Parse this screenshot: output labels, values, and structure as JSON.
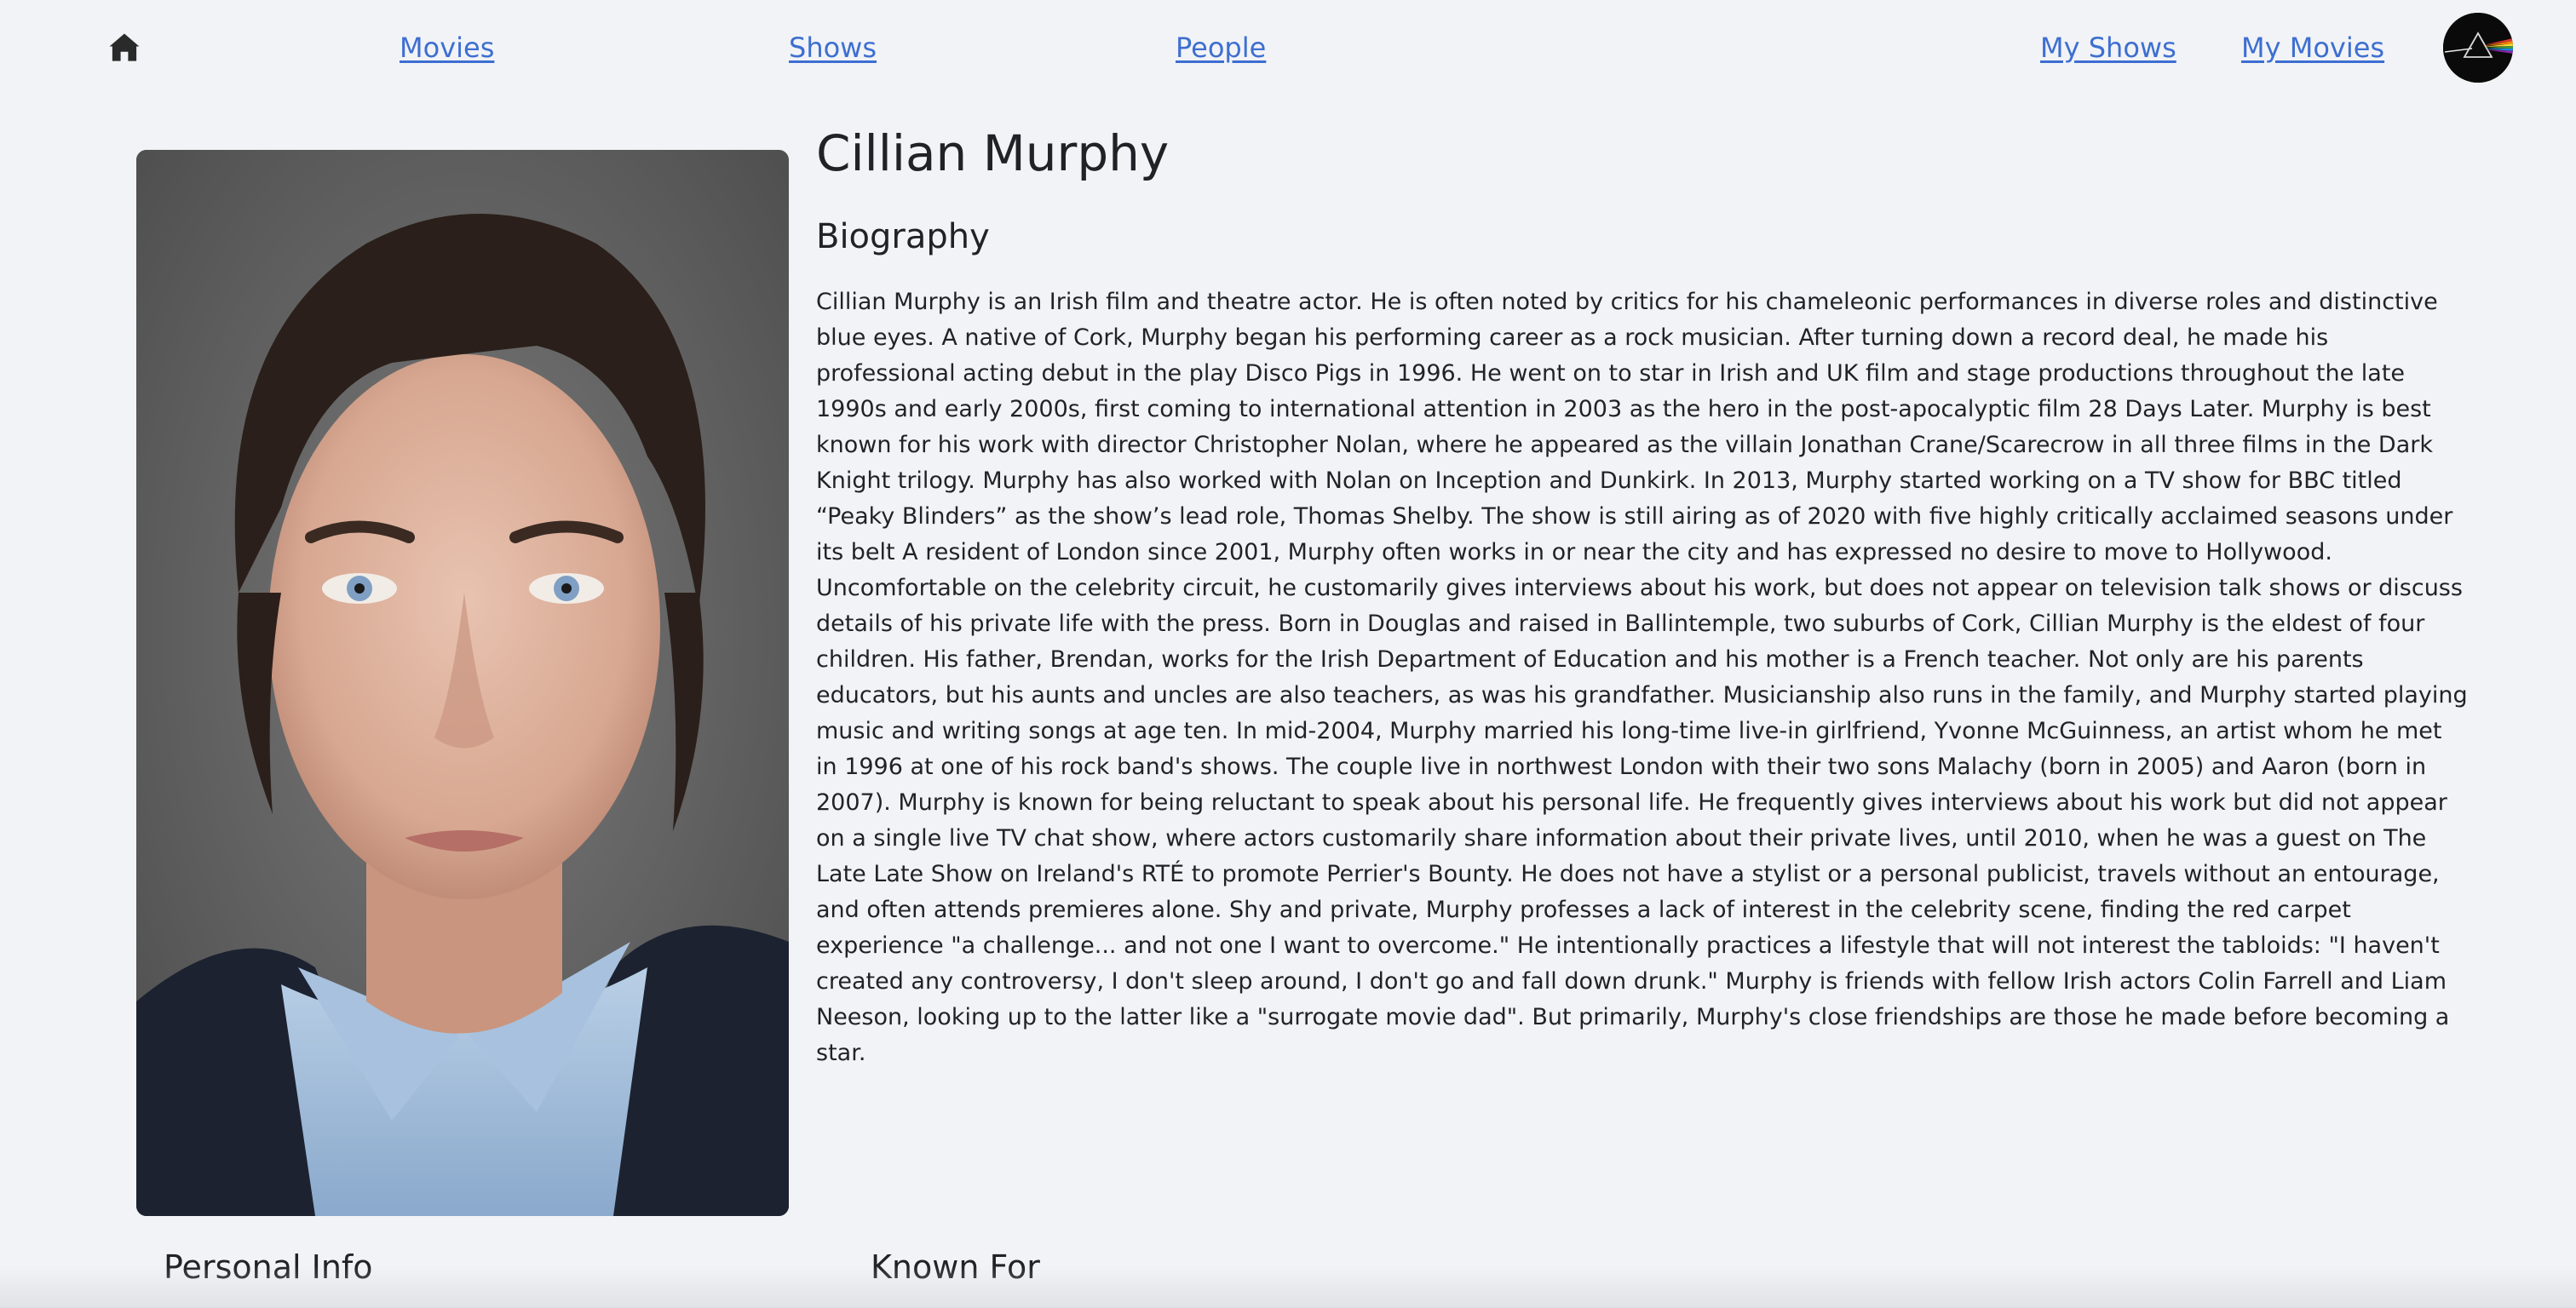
{
  "nav": {
    "home_icon": "home-icon",
    "movies_label": "Movies",
    "shows_label": "Shows",
    "people_label": "People",
    "my_shows_label": "My Shows",
    "my_movies_label": "My Movies",
    "avatar_icon": "prism-avatar-icon",
    "link_color": "#3d6fd1"
  },
  "person": {
    "name": "Cillian Murphy",
    "biography_heading": "Biography",
    "biography": "Cillian Murphy is an Irish film and theatre actor. He is often noted by critics for his chameleonic performances in diverse roles and distinctive blue eyes. A native of Cork, Murphy began his performing career as a rock musician. After turning down a record deal, he made his professional acting debut in the play Disco Pigs in 1996. He went on to star in Irish and UK film and stage productions throughout the late 1990s and early 2000s, first coming to international attention in 2003 as the hero in the post-apocalyptic film 28 Days Later. Murphy is best known for his work with director Christopher Nolan, where he appeared as the villain Jonathan Crane/Scarecrow in all three films in the Dark Knight trilogy. Murphy has also worked with Nolan on Inception and Dunkirk. In 2013, Murphy started working on a TV show for BBC titled “Peaky Blinders” as the show’s lead role, Thomas Shelby. The show is still airing as of 2020 with five highly critically acclaimed seasons under its belt A resident of London since 2001, Murphy often works in or near the city and has expressed no desire to move to Hollywood. Uncomfortable on the celebrity circuit, he customarily gives interviews about his work, but does not appear on television talk shows or discuss details of his private life with the press. Born in Douglas and raised in Ballintemple, two suburbs of Cork, Cillian Murphy is the eldest of four children. His father, Brendan, works for the Irish Department of Education and his mother is a French teacher. Not only are his parents educators, but his aunts and uncles are also teachers, as was his grandfather. Musicianship also runs in the family, and Murphy started playing music and writing songs at age ten. In mid-2004, Murphy married his long-time live-in girlfriend, Yvonne McGuinness, an artist whom he met in 1996 at one of his rock band's shows. The couple live in northwest London with their two sons Malachy (born in 2005) and Aaron (born in 2007). Murphy is known for being reluctant to speak about his personal life. He frequently gives interviews about his work but did not appear on a single live TV chat show, where actors customarily share information about their private lives, until 2010, when he was a guest on The Late Late Show on Ireland's RTÉ to promote Perrier's Bounty. He does not have a stylist or a personal publicist, travels without an entourage, and often attends premieres alone. Shy and private, Murphy professes a lack of interest in the celebrity scene, finding the red carpet experience \"a challenge... and not one I want to overcome.\" He intentionally practices a lifestyle that will not interest the tabloids: \"I haven't created any controversy, I don't sleep around, I don't go and fall down drunk.\" Murphy is friends with fellow Irish actors Colin Farrell and Liam Neeson, looking up to the latter like a \"surrogate movie dad\". But primarily, Murphy's close friendships are those he made before becoming a star.",
    "portrait": "person-portrait-photo"
  },
  "sections": {
    "personal_info_heading": "Personal Info",
    "known_for_heading": "Known For"
  }
}
